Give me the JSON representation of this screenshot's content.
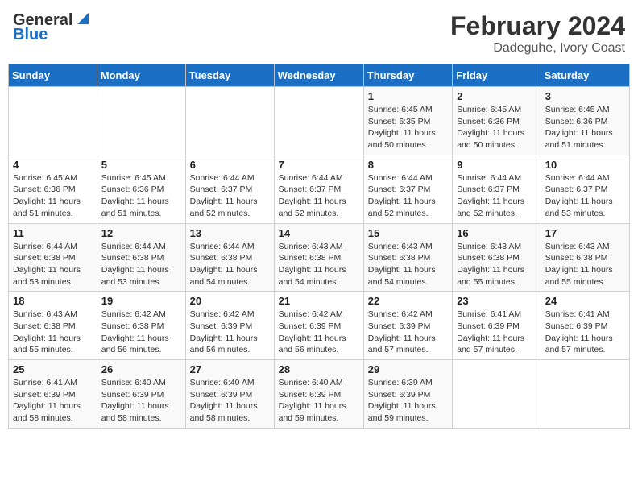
{
  "logo": {
    "line1": "General",
    "line2": "Blue"
  },
  "title": "February 2024",
  "subtitle": "Dadeguhe, Ivory Coast",
  "days_of_week": [
    "Sunday",
    "Monday",
    "Tuesday",
    "Wednesday",
    "Thursday",
    "Friday",
    "Saturday"
  ],
  "weeks": [
    [
      {
        "day": "",
        "info": ""
      },
      {
        "day": "",
        "info": ""
      },
      {
        "day": "",
        "info": ""
      },
      {
        "day": "",
        "info": ""
      },
      {
        "day": "1",
        "info": "Sunrise: 6:45 AM\nSunset: 6:35 PM\nDaylight: 11 hours\nand 50 minutes."
      },
      {
        "day": "2",
        "info": "Sunrise: 6:45 AM\nSunset: 6:36 PM\nDaylight: 11 hours\nand 50 minutes."
      },
      {
        "day": "3",
        "info": "Sunrise: 6:45 AM\nSunset: 6:36 PM\nDaylight: 11 hours\nand 51 minutes."
      }
    ],
    [
      {
        "day": "4",
        "info": "Sunrise: 6:45 AM\nSunset: 6:36 PM\nDaylight: 11 hours\nand 51 minutes."
      },
      {
        "day": "5",
        "info": "Sunrise: 6:45 AM\nSunset: 6:36 PM\nDaylight: 11 hours\nand 51 minutes."
      },
      {
        "day": "6",
        "info": "Sunrise: 6:44 AM\nSunset: 6:37 PM\nDaylight: 11 hours\nand 52 minutes."
      },
      {
        "day": "7",
        "info": "Sunrise: 6:44 AM\nSunset: 6:37 PM\nDaylight: 11 hours\nand 52 minutes."
      },
      {
        "day": "8",
        "info": "Sunrise: 6:44 AM\nSunset: 6:37 PM\nDaylight: 11 hours\nand 52 minutes."
      },
      {
        "day": "9",
        "info": "Sunrise: 6:44 AM\nSunset: 6:37 PM\nDaylight: 11 hours\nand 52 minutes."
      },
      {
        "day": "10",
        "info": "Sunrise: 6:44 AM\nSunset: 6:37 PM\nDaylight: 11 hours\nand 53 minutes."
      }
    ],
    [
      {
        "day": "11",
        "info": "Sunrise: 6:44 AM\nSunset: 6:38 PM\nDaylight: 11 hours\nand 53 minutes."
      },
      {
        "day": "12",
        "info": "Sunrise: 6:44 AM\nSunset: 6:38 PM\nDaylight: 11 hours\nand 53 minutes."
      },
      {
        "day": "13",
        "info": "Sunrise: 6:44 AM\nSunset: 6:38 PM\nDaylight: 11 hours\nand 54 minutes."
      },
      {
        "day": "14",
        "info": "Sunrise: 6:43 AM\nSunset: 6:38 PM\nDaylight: 11 hours\nand 54 minutes."
      },
      {
        "day": "15",
        "info": "Sunrise: 6:43 AM\nSunset: 6:38 PM\nDaylight: 11 hours\nand 54 minutes."
      },
      {
        "day": "16",
        "info": "Sunrise: 6:43 AM\nSunset: 6:38 PM\nDaylight: 11 hours\nand 55 minutes."
      },
      {
        "day": "17",
        "info": "Sunrise: 6:43 AM\nSunset: 6:38 PM\nDaylight: 11 hours\nand 55 minutes."
      }
    ],
    [
      {
        "day": "18",
        "info": "Sunrise: 6:43 AM\nSunset: 6:38 PM\nDaylight: 11 hours\nand 55 minutes."
      },
      {
        "day": "19",
        "info": "Sunrise: 6:42 AM\nSunset: 6:38 PM\nDaylight: 11 hours\nand 56 minutes."
      },
      {
        "day": "20",
        "info": "Sunrise: 6:42 AM\nSunset: 6:39 PM\nDaylight: 11 hours\nand 56 minutes."
      },
      {
        "day": "21",
        "info": "Sunrise: 6:42 AM\nSunset: 6:39 PM\nDaylight: 11 hours\nand 56 minutes."
      },
      {
        "day": "22",
        "info": "Sunrise: 6:42 AM\nSunset: 6:39 PM\nDaylight: 11 hours\nand 57 minutes."
      },
      {
        "day": "23",
        "info": "Sunrise: 6:41 AM\nSunset: 6:39 PM\nDaylight: 11 hours\nand 57 minutes."
      },
      {
        "day": "24",
        "info": "Sunrise: 6:41 AM\nSunset: 6:39 PM\nDaylight: 11 hours\nand 57 minutes."
      }
    ],
    [
      {
        "day": "25",
        "info": "Sunrise: 6:41 AM\nSunset: 6:39 PM\nDaylight: 11 hours\nand 58 minutes."
      },
      {
        "day": "26",
        "info": "Sunrise: 6:40 AM\nSunset: 6:39 PM\nDaylight: 11 hours\nand 58 minutes."
      },
      {
        "day": "27",
        "info": "Sunrise: 6:40 AM\nSunset: 6:39 PM\nDaylight: 11 hours\nand 58 minutes."
      },
      {
        "day": "28",
        "info": "Sunrise: 6:40 AM\nSunset: 6:39 PM\nDaylight: 11 hours\nand 59 minutes."
      },
      {
        "day": "29",
        "info": "Sunrise: 6:39 AM\nSunset: 6:39 PM\nDaylight: 11 hours\nand 59 minutes."
      },
      {
        "day": "",
        "info": ""
      },
      {
        "day": "",
        "info": ""
      }
    ]
  ]
}
